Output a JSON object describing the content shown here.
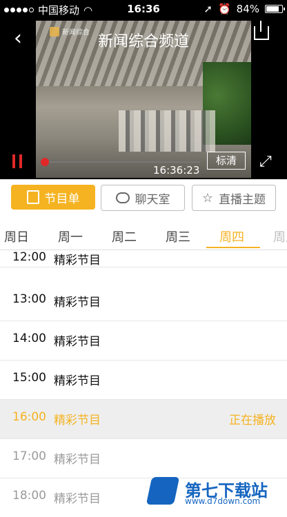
{
  "status": {
    "carrier": "中国移动",
    "time": "16:36",
    "battery": "84%"
  },
  "player": {
    "title": "新闻综合频道",
    "logo_text": "新闻综合",
    "current_time": "16:36:23",
    "quality": "标清",
    "progress_fraction": 0.02
  },
  "actions": {
    "program_list": "节目单",
    "chat_room": "聊天室",
    "live_topic": "直播主题"
  },
  "days": [
    "周日",
    "周一",
    "周二",
    "周三",
    "周四",
    "周五"
  ],
  "active_day": "周四",
  "schedule": [
    {
      "time": "12:00",
      "name": "精彩节目",
      "state": "past"
    },
    {
      "time": "13:00",
      "name": "精彩节目",
      "state": "past"
    },
    {
      "time": "14:00",
      "name": "精彩节目",
      "state": "past"
    },
    {
      "time": "15:00",
      "name": "精彩节目",
      "state": "past"
    },
    {
      "time": "16:00",
      "name": "精彩节目",
      "state": "now",
      "badge": "正在播放"
    },
    {
      "time": "17:00",
      "name": "精彩节目",
      "state": "future"
    },
    {
      "time": "18:00",
      "name": "精彩节目",
      "state": "future"
    }
  ],
  "watermark": {
    "name": "第七下载站",
    "url": "www.d7down.com"
  },
  "colors": {
    "accent": "#f5b321",
    "live": "#e02828"
  }
}
